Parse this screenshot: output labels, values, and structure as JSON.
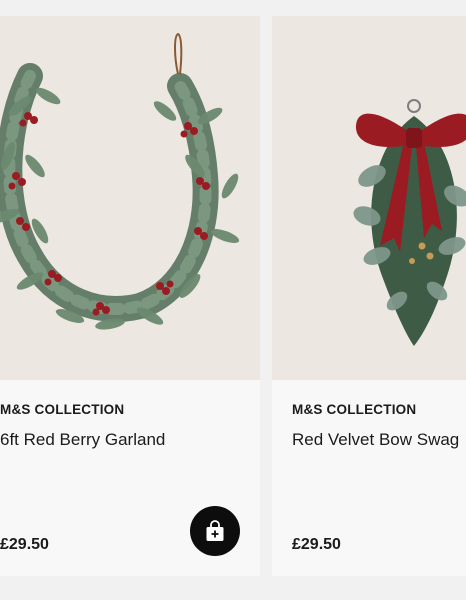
{
  "products": [
    {
      "brand": "M&S COLLECTION",
      "name": "6ft Red Berry Garland",
      "price": "£29.50",
      "image_icon": "garland-image",
      "action_icon": "shopping-bag-add-icon"
    },
    {
      "brand": "M&S COLLECTION",
      "name": "Red Velvet Bow Swag",
      "price": "£29.50",
      "image_icon": "wreath-swag-image"
    }
  ],
  "colors": {
    "page_bg": "#f1f1f1",
    "card_bg": "#f8f8f8",
    "image_bg": "#ece7e1",
    "text": "#1b1b1b",
    "button_bg": "#0d0d0d",
    "berry_red": "#9b1b22",
    "leaf_green": "#5f7a63"
  }
}
